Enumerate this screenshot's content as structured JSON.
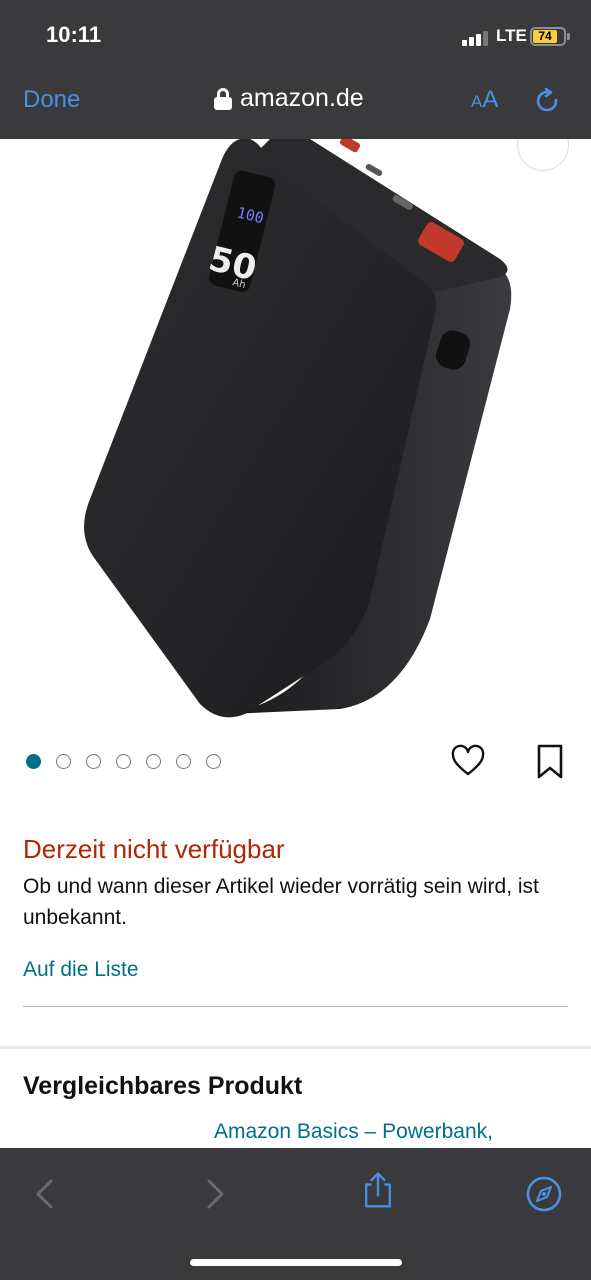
{
  "status_bar": {
    "time": "10:11",
    "network": "LTE",
    "battery": "74"
  },
  "browser": {
    "done_label": "Done",
    "url": "amazon.de",
    "text_size_label_small": "A",
    "text_size_label_large": "A"
  },
  "product": {
    "image_alt": "power-bank-product-photo",
    "display_text": "100",
    "display_capacity": "50",
    "display_unit": "Ah",
    "carousel": {
      "total": 7,
      "active_index": 0
    }
  },
  "availability": {
    "title": "Derzeit nicht verfügbar",
    "description": "Ob und wann dieser Artikel wieder vorrätig sein wird, ist unbekannt.",
    "add_to_list_label": "Auf die Liste"
  },
  "comparison": {
    "title": "Vergleichbares Produkt",
    "link_text": "Amazon Basics – Powerbank,"
  },
  "colors": {
    "chrome_bg": "#3a3a3c",
    "accent_blue": "#4a90e2",
    "availability_red": "#b12704",
    "link_teal": "#00708a"
  },
  "toolbar": {
    "icons": [
      "back-icon",
      "forward-icon",
      "share-icon",
      "compass-icon"
    ]
  }
}
